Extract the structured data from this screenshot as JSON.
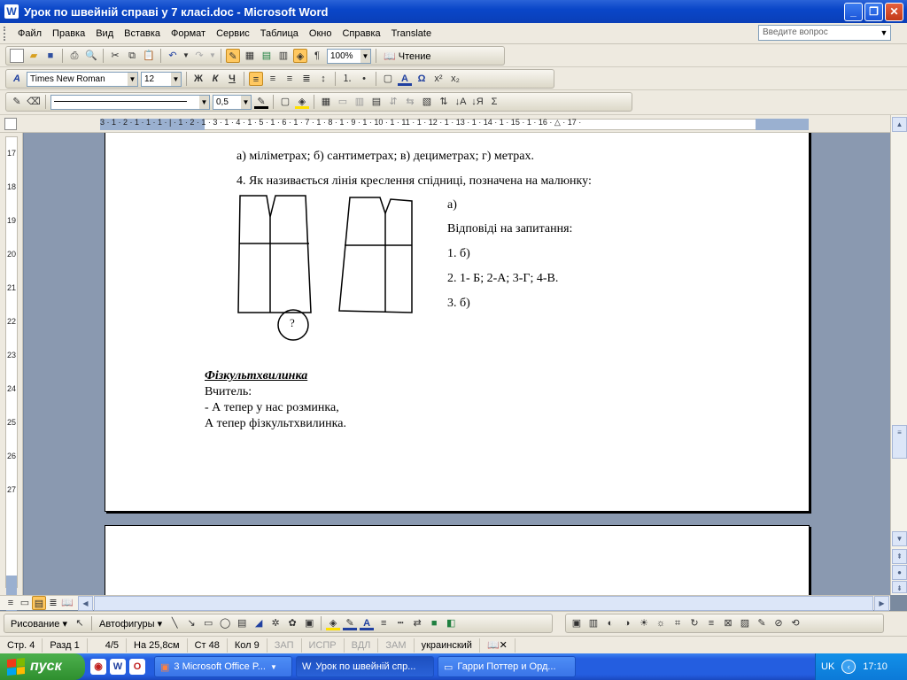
{
  "window": {
    "title": "Урок  по швейній справі у 7 класі.doc - Microsoft Word",
    "icon_letter": "W"
  },
  "menu": {
    "items": [
      "Файл",
      "Правка",
      "Вид",
      "Вставка",
      "Формат",
      "Сервис",
      "Таблица",
      "Окно",
      "Справка",
      "Translate"
    ],
    "ask_placeholder": "Введите вопрос"
  },
  "toolbar_standard": {
    "zoom": "100%",
    "reading_label": "Чтение"
  },
  "toolbar_format": {
    "font": "Times New Roman",
    "size": "12",
    "bold": "Ж",
    "italic": "К",
    "underline": "Ч"
  },
  "toolbar_tables": {
    "line_weight": "0,5"
  },
  "ruler": {
    "h_numbers": "3 · 1 · 2 · 1 · 1 · 1 · | · 1 · 2 · 1 · 3 · 1 · 4 · 1 · 5 · 1 · 6 · 1 · 7 · 1 · 8 · 1 · 9 · 1 · 10 · 1 · 11 · 1 · 12 · 1 · 13 · 1 · 14 · 1 · 15 · 1 · 16 · △ · 17 ·",
    "v_numbers": [
      "17",
      "18",
      "19",
      "20",
      "21",
      "22",
      "23",
      "24",
      "25",
      "26",
      "27"
    ]
  },
  "document": {
    "line1": "а) міліметрах;   б) сантиметрах;   в) дециметрах;    г) метрах.",
    "line2": "4.  Як називається лінія креслення спідниці, позначена  на малюнку:",
    "ans_a": "а)",
    "answers_title": "Відповіді на запитання:",
    "ans1": "1. б)",
    "ans2": "2.   1- Б;   2-А;   3-Г;   4-В.",
    "ans3": "3. б)",
    "question_mark": "?",
    "heading": "Фізкультхвилинка",
    "teacher": "Вчитель:",
    "verse1": "- А тепер у нас розминка,",
    "verse2": "А тепер фізкультхвилинка."
  },
  "drawing_toolbar": {
    "draw_label": "Рисование",
    "autoshapes_label": "Автофигуры"
  },
  "status": {
    "page": "Стр. 4",
    "section": "Разд 1",
    "pages": "4/5",
    "at": "На 25,8см",
    "line": "Ст 48",
    "col": "Кол 9",
    "rec": "ЗАП",
    "trk": "ИСПР",
    "ext": "ВДЛ",
    "ovr": "ЗАМ",
    "lang": "украинский"
  },
  "taskbar": {
    "start_label": "пуск",
    "tasks": [
      "3 Microsoft Office P...",
      "Урок  по швейній спр...",
      "Гарри Поттер и Орд..."
    ],
    "lang": "UK",
    "clock": "17:10"
  },
  "colors": {
    "title_blue": "#0a46c8",
    "taskbar_blue": "#245ee0",
    "start_green": "#2f8f2f",
    "ruler_margin": "#9ab0d0",
    "doc_bg": "#8a99b0"
  }
}
